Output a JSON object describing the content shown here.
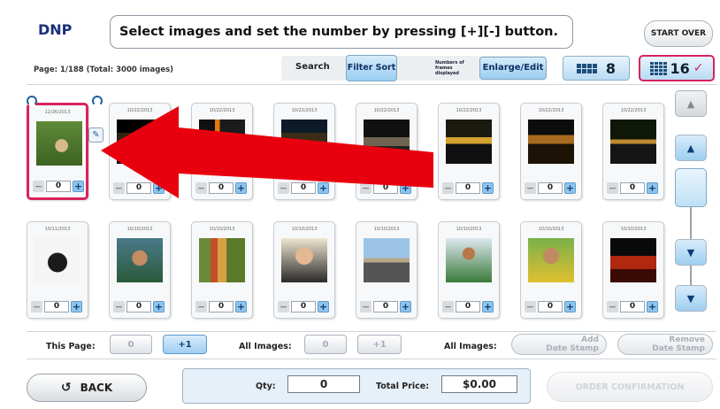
{
  "header": {
    "logo": "DNP",
    "instruction": "Select images and set the number by pressing [+][-] button.",
    "start_over": "START OVER"
  },
  "toolbar": {
    "page_info": "Page: 1/188 (Total: 3000 images)",
    "search_label": "Search",
    "filter_sort": "Filter Sort",
    "numbers_of_frames_label": "Numbers of frames displayed",
    "enlarge_edit": "Enlarge/Edit",
    "grid_8_label": "8",
    "grid_16_label": "16",
    "selected_grid": "16"
  },
  "cards": [
    {
      "date": "12/26/2013",
      "qty": "0",
      "selected": true,
      "photo": "cat-in-grass"
    },
    {
      "date": "10/22/2013",
      "qty": "0",
      "selected": false,
      "photo": "night-street"
    },
    {
      "date": "10/22/2013",
      "qty": "0",
      "selected": false,
      "photo": "night-lights"
    },
    {
      "date": "10/22/2013",
      "qty": "0",
      "selected": false,
      "photo": "night-city"
    },
    {
      "date": "10/22/2013",
      "qty": "0",
      "selected": false,
      "photo": "night-buildings"
    },
    {
      "date": "10/22/2013",
      "qty": "0",
      "selected": false,
      "photo": "night-traffic"
    },
    {
      "date": "10/22/2013",
      "qty": "0",
      "selected": false,
      "photo": "night-skyline"
    },
    {
      "date": "10/22/2013",
      "qty": "0",
      "selected": false,
      "photo": "night-road"
    },
    {
      "date": "10/11/2013",
      "qty": "0",
      "selected": false,
      "photo": "gorilla"
    },
    {
      "date": "10/10/2013",
      "qty": "0",
      "selected": false,
      "photo": "girl-portrait"
    },
    {
      "date": "10/10/2013",
      "qty": "0",
      "selected": false,
      "photo": "dancers"
    },
    {
      "date": "10/10/2013",
      "qty": "0",
      "selected": false,
      "photo": "woman-portrait"
    },
    {
      "date": "10/10/2013",
      "qty": "0",
      "selected": false,
      "photo": "desert-road"
    },
    {
      "date": "10/10/2013",
      "qty": "0",
      "selected": false,
      "photo": "hula-dancer"
    },
    {
      "date": "10/10/2013",
      "qty": "0",
      "selected": false,
      "photo": "lei-woman"
    },
    {
      "date": "10/10/2013",
      "qty": "0",
      "selected": false,
      "photo": "lava"
    }
  ],
  "bottom": {
    "this_page_label": "This Page:",
    "this_page_zero": "0",
    "this_page_plus": "+1",
    "all_images_label": "All Images:",
    "all_images_zero": "0",
    "all_images_plus": "+1",
    "all_images_label_2": "All Images:",
    "add_date_stamp_line1": "Add",
    "add_date_stamp_line2": "Date Stamp",
    "remove_date_stamp_line1": "Remove",
    "remove_date_stamp_line2": "Date Stamp"
  },
  "footer": {
    "back": "BACK",
    "qty_label": "Qty:",
    "qty_value": "0",
    "total_price_label": "Total Price:",
    "total_price_value": "$0.00",
    "order_confirmation": "ORDER CONFIRMATION"
  },
  "colors": {
    "accent_pink": "#d7245d",
    "button_blue": "#9fcef0",
    "annotation_arrow": "#e8000e"
  }
}
